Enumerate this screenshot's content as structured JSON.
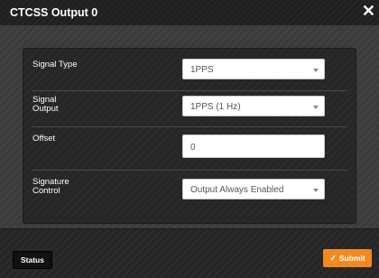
{
  "dialog": {
    "title": "CTCSS Output 0",
    "close_glyph": "✕"
  },
  "form": {
    "signal_type": {
      "label": "Signal Type",
      "value": "1PPS"
    },
    "signal_output": {
      "label_line1": "Signal",
      "label_line2": "Output",
      "value": "1PPS (1 Hz)"
    },
    "offset": {
      "label": "Offset",
      "value": "0"
    },
    "signature_control": {
      "label_line1": "Signature",
      "label_line2": "Control",
      "value": "Output Always Enabled"
    }
  },
  "footer": {
    "status_label": "Status",
    "submit_label": "Submit",
    "submit_icon": "check-icon"
  },
  "colors": {
    "accent": "#f28a1f",
    "background": "#3b3b3b",
    "panel": "#262626"
  }
}
